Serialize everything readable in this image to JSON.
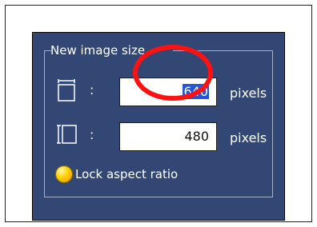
{
  "dialog": {
    "title": "New image size"
  },
  "width": {
    "colon": ":",
    "value": "640",
    "unit": "pixels",
    "icon": "width-icon"
  },
  "height": {
    "colon": ":",
    "value": "480",
    "unit": "pixels",
    "icon": "height-icon"
  },
  "aspect": {
    "label": "Lock aspect ratio",
    "icon": "lock-aspect-ratio-radio"
  },
  "annotation": {
    "type": "red-circle-highlight",
    "color": "#ff1111"
  },
  "colors": {
    "panel_bg": "#334774",
    "text": "#ffffff",
    "selection": "#2356d8",
    "radio": "#ffd400"
  }
}
